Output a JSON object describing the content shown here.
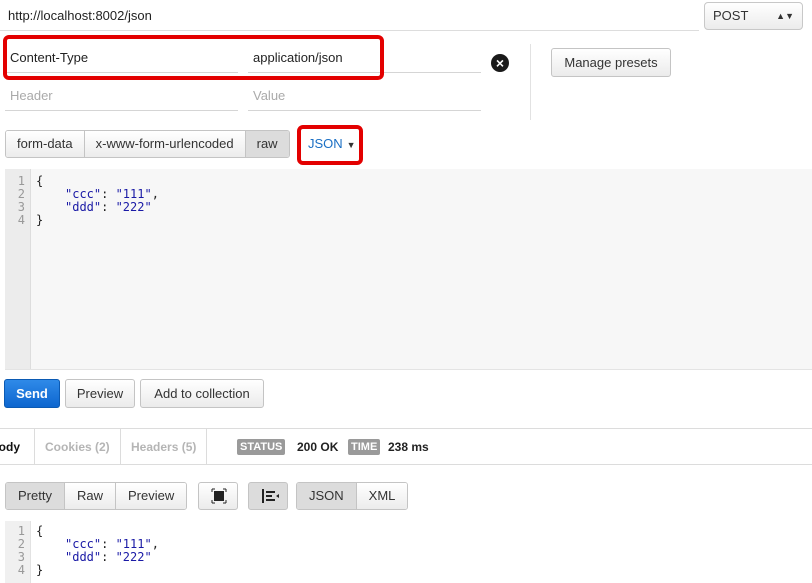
{
  "request": {
    "url": "http://localhost:8002/json",
    "method": "POST"
  },
  "headers": {
    "rows": [
      {
        "key": "Content-Type",
        "value": "application/json"
      }
    ],
    "key_placeholder": "Header",
    "value_placeholder": "Value",
    "manage_presets_label": "Manage presets",
    "remove_icon": "close-circle-icon"
  },
  "body_tabs": {
    "items": [
      "form-data",
      "x-www-form-urlencoded",
      "raw"
    ],
    "active": "raw",
    "content_type": "JSON"
  },
  "request_body": {
    "line_numbers": [
      "1",
      "2",
      "3",
      "4"
    ],
    "line1": "{",
    "line2_key": "\"ccc\"",
    "line2_val": "\"111\"",
    "line3_key": "\"ddd\"",
    "line3_val": "\"222\"",
    "line4": "}"
  },
  "actions": {
    "send_label": "Send",
    "preview_label": "Preview",
    "add_label": "Add to collection"
  },
  "response": {
    "tabs": [
      "Body",
      "Cookies (2)",
      "Headers (5)"
    ],
    "status_label": "STATUS",
    "status_value": "200 OK",
    "time_label": "TIME",
    "time_value": "238 ms",
    "format_tabs": [
      "Pretty",
      "Raw",
      "Preview"
    ],
    "active_format": "Pretty",
    "type_tabs": [
      "JSON",
      "XML"
    ],
    "active_type": "JSON",
    "expand_icon": "expand-icon",
    "wrap_icon": "wrap-lines-icon"
  },
  "response_body": {
    "line_numbers": [
      "1",
      "2",
      "3",
      "4"
    ],
    "line1": "{",
    "line2_key": "\"ccc\"",
    "line2_val": "\"111\"",
    "line3_key": "\"ddd\"",
    "line3_val": "\"222\"",
    "line4": "}"
  },
  "colors": {
    "highlight": "#e30000",
    "send": "#0d66cf",
    "link": "#1a6fc4"
  }
}
